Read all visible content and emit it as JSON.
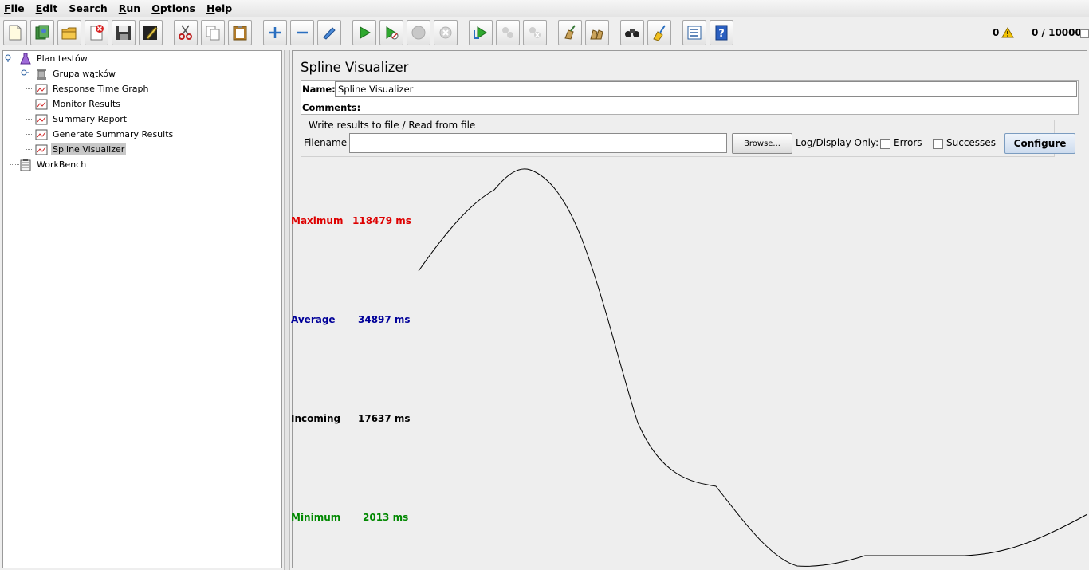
{
  "menu": [
    {
      "label": "File",
      "u": "F",
      "rest": "ile"
    },
    {
      "label": "Edit",
      "u": "E",
      "rest": "dit"
    },
    {
      "label": "Search",
      "u": "",
      "rest": "Search"
    },
    {
      "label": "Run",
      "u": "R",
      "rest": "un"
    },
    {
      "label": "Options",
      "u": "O",
      "rest": "ptions"
    },
    {
      "label": "Help",
      "u": "H",
      "rest": "elp"
    }
  ],
  "status": {
    "error_count": "0",
    "threads": "0 / 10000"
  },
  "tree": {
    "plan": "Plan testów",
    "thread_group": "Grupa wątków",
    "items": [
      "Response Time Graph",
      "Monitor Results",
      "Summary Report",
      "Generate Summary Results",
      "Spline Visualizer"
    ],
    "workbench": "WorkBench"
  },
  "panel": {
    "title": "Spline Visualizer",
    "name_label": "Name:",
    "name_value": "Spline Visualizer",
    "comments_label": "Comments:",
    "file_group_title": "Write results to file / Read from file",
    "filename_label": "Filename",
    "filename_value": "",
    "browse_label": "Browse...",
    "log_display_label": "Log/Display Only:",
    "errors_label": "Errors",
    "successes_label": "Successes",
    "configure_label": "Configure"
  },
  "stats": {
    "maximum": {
      "label": "Maximum",
      "value": "118479 ms",
      "color": "#dd0000"
    },
    "average": {
      "label": "Average",
      "value": "34897 ms",
      "color": "#000099"
    },
    "incoming": {
      "label": "Incoming",
      "value": "17637 ms",
      "color": "#000000"
    },
    "minimum": {
      "label": "Minimum",
      "value": "2013 ms",
      "color": "#008800"
    }
  }
}
